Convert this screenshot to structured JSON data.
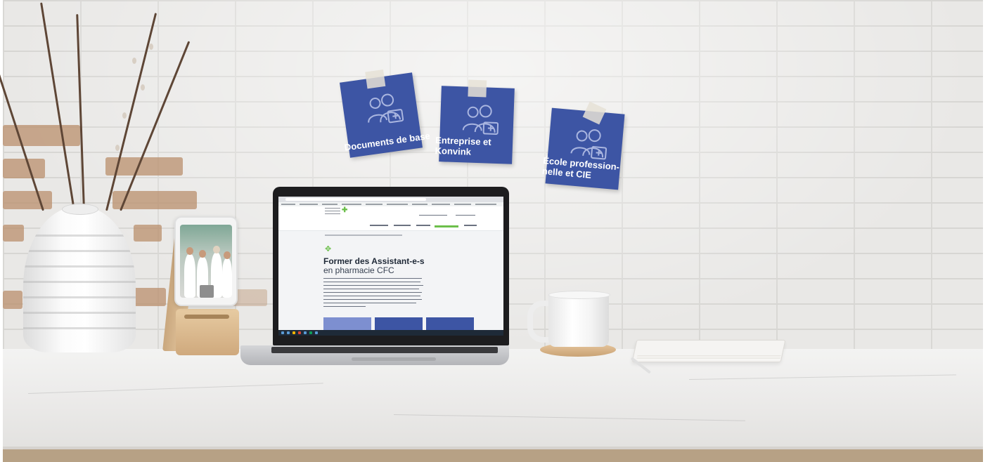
{
  "notes": [
    {
      "label": "Documents de base"
    },
    {
      "label": "Entreprise et Konvink"
    },
    {
      "label": "École profession-nelle et CIE"
    }
  ],
  "laptop": {
    "page_title": "Former des Assistant-e-s",
    "page_subtitle": "en pharmacie CFC",
    "logo_icon": "green-cross-icon",
    "page_icon": "handshake-icon"
  },
  "colors": {
    "note_blue": "#3d55a4",
    "accent_green": "#6cbf4b"
  }
}
